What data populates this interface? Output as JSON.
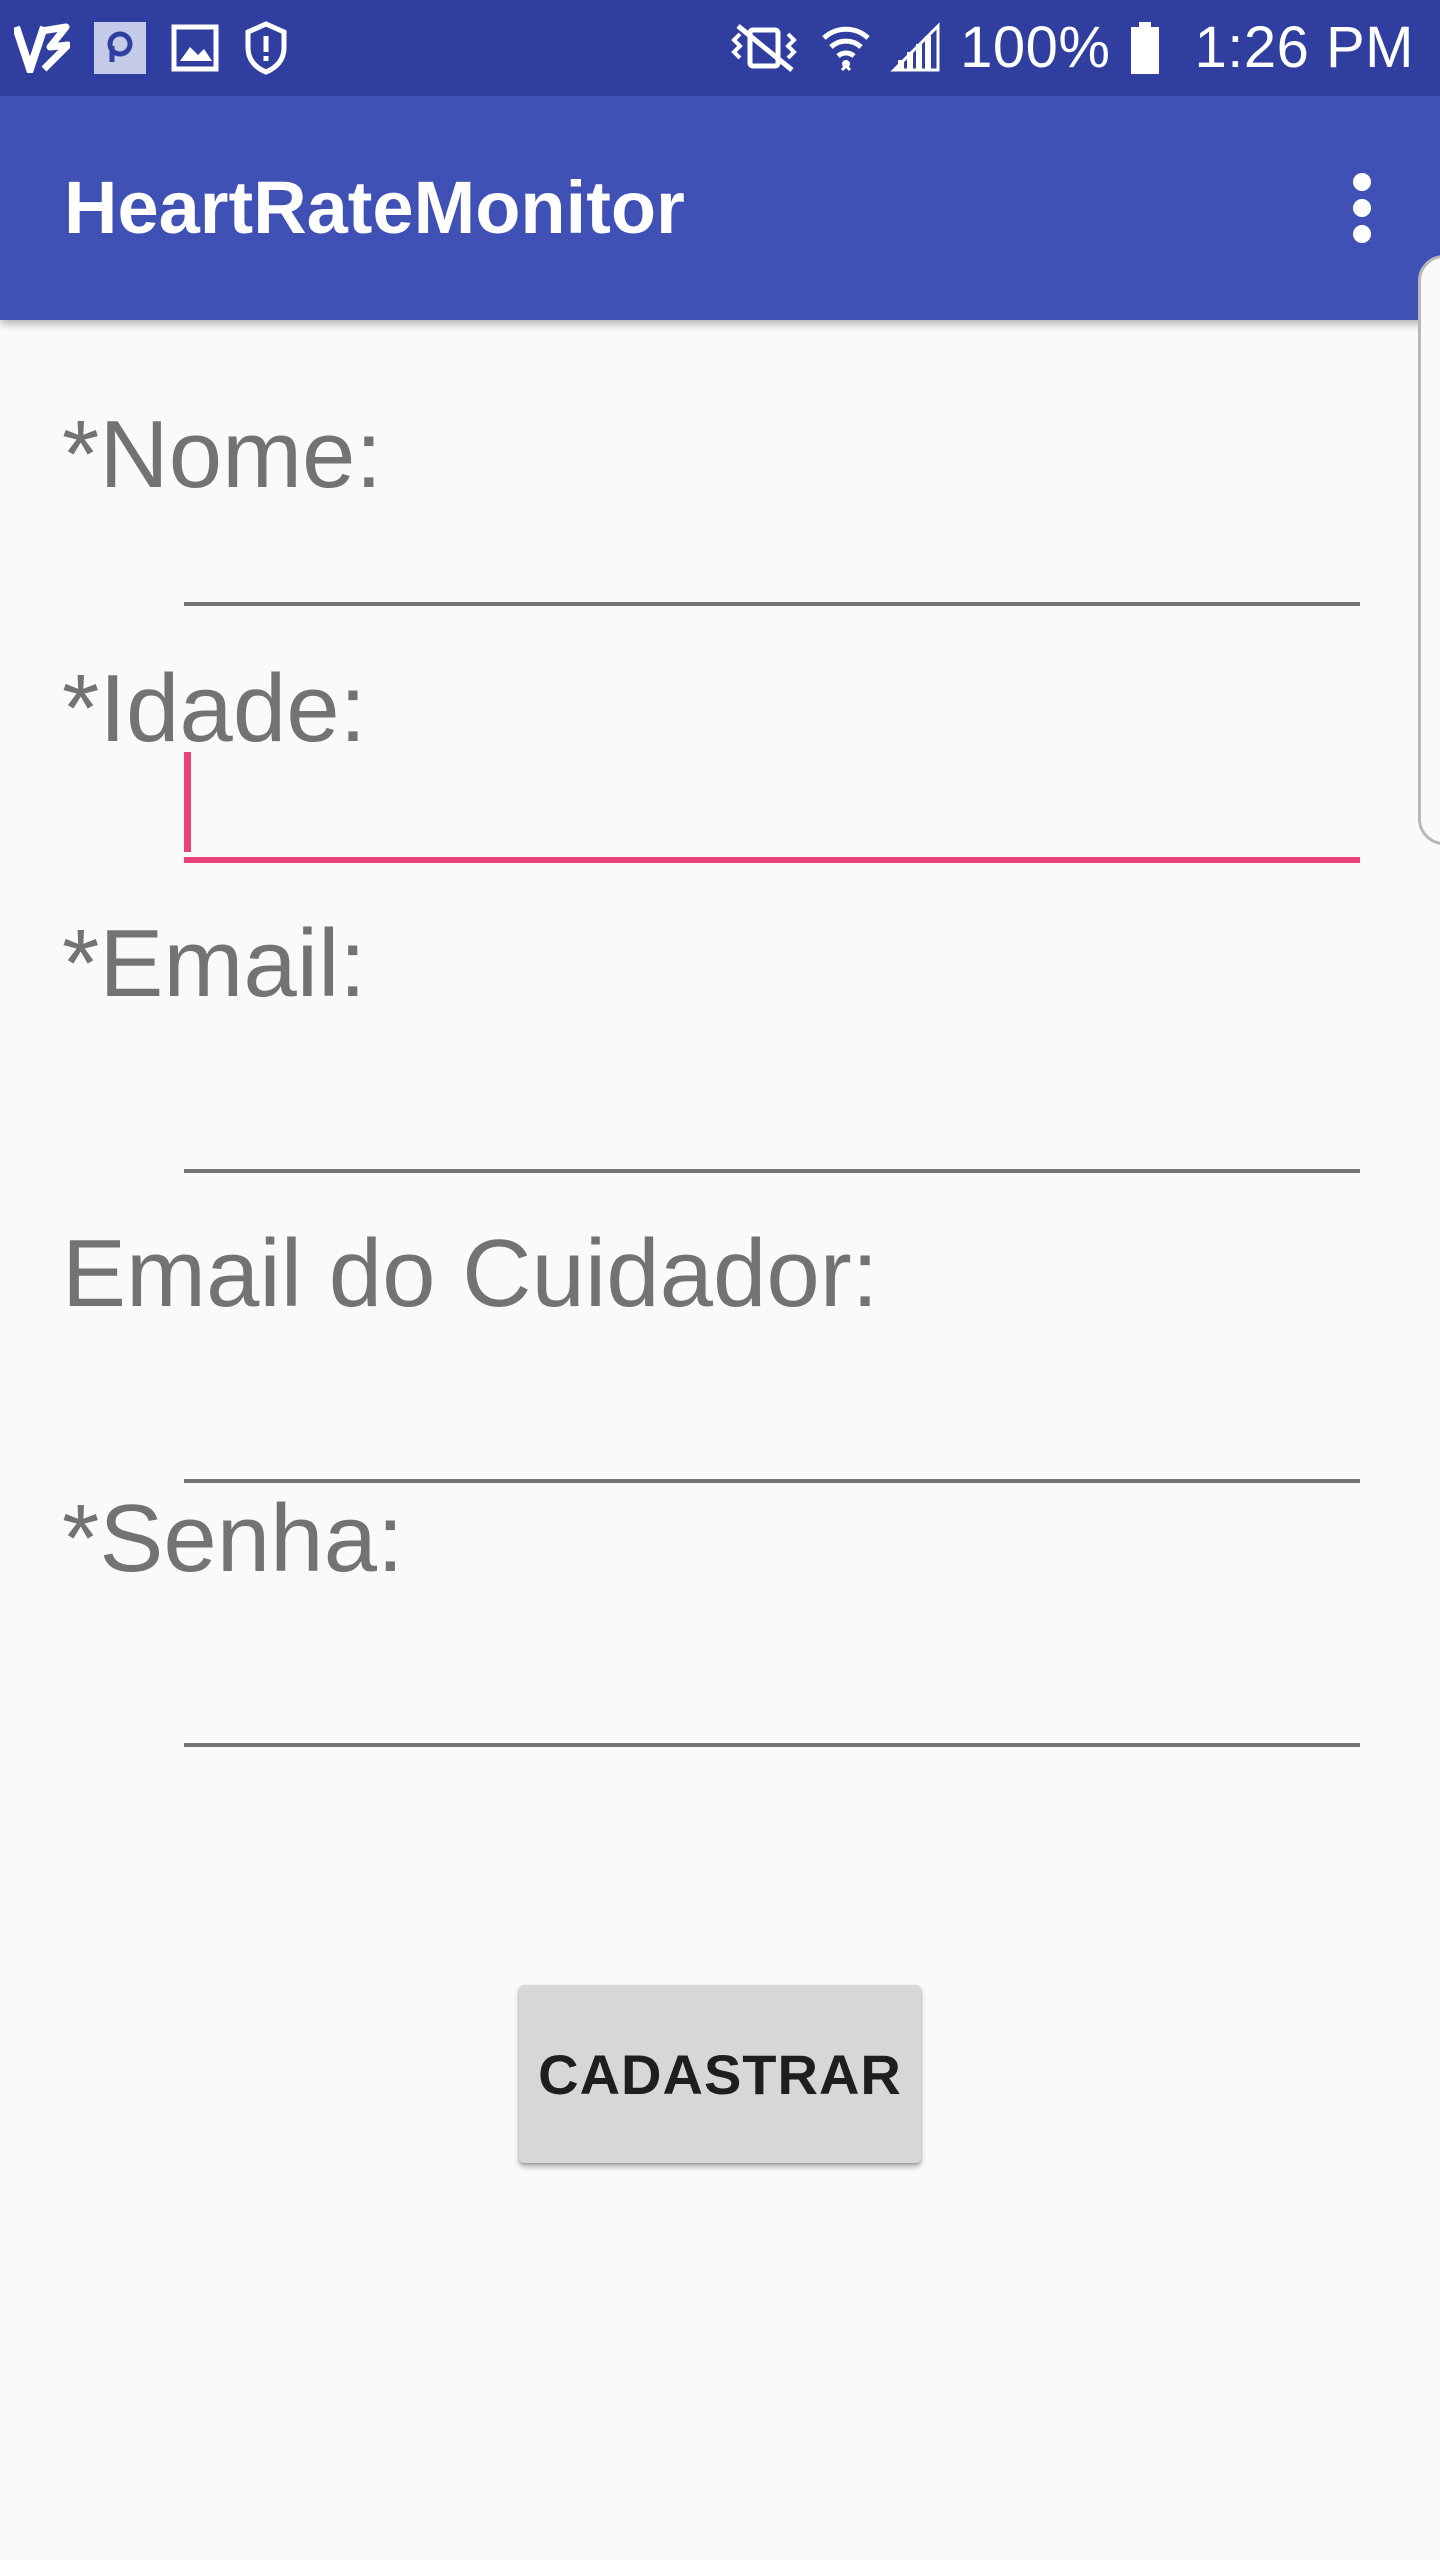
{
  "status_bar": {
    "battery": "100%",
    "time": "1:26 PM"
  },
  "app_bar": {
    "title": "HeartRateMonitor"
  },
  "form": {
    "fields": [
      {
        "label": "*Nome:",
        "value": ""
      },
      {
        "label": "*Idade:",
        "value": ""
      },
      {
        "label": "*Email:",
        "value": ""
      },
      {
        "label": "Email do Cuidador:",
        "value": ""
      },
      {
        "label": "*Senha:",
        "value": ""
      }
    ],
    "submit_label": "CADASTRAR"
  },
  "colors": {
    "status_bar": "#303f9f",
    "app_bar": "#3f51b5",
    "accent": "#ec407a",
    "background": "#fafafa"
  }
}
